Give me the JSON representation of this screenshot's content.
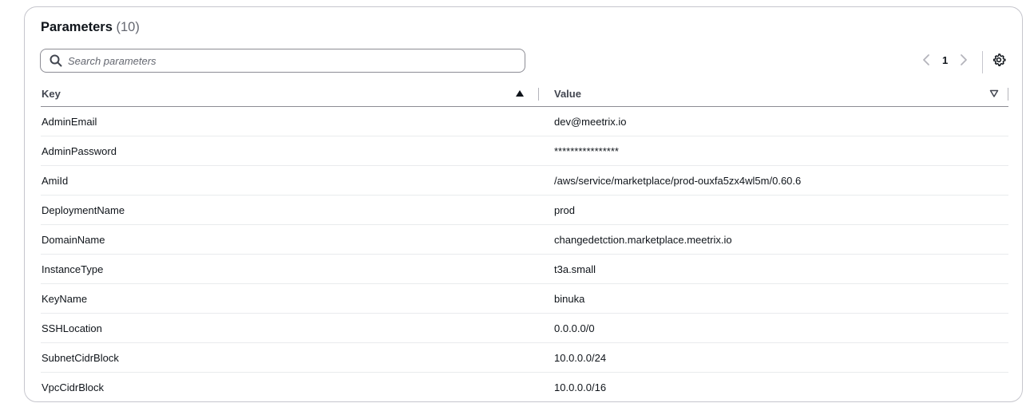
{
  "panel": {
    "title": "Parameters",
    "count": "(10)"
  },
  "search": {
    "placeholder": "Search parameters",
    "value": ""
  },
  "pagination": {
    "current_page": "1"
  },
  "table": {
    "columns": [
      "Key",
      "Value"
    ],
    "rows": [
      {
        "key": "AdminEmail",
        "value": "dev@meetrix.io"
      },
      {
        "key": "AdminPassword",
        "value": "****************"
      },
      {
        "key": "AmiId",
        "value": "/aws/service/marketplace/prod-ouxfa5zx4wl5m/0.60.6"
      },
      {
        "key": "DeploymentName",
        "value": "prod"
      },
      {
        "key": "DomainName",
        "value": "changedetction.marketplace.meetrix.io"
      },
      {
        "key": "InstanceType",
        "value": "t3a.small"
      },
      {
        "key": "KeyName",
        "value": "binuka"
      },
      {
        "key": "SSHLocation",
        "value": "0.0.0.0/0"
      },
      {
        "key": "SubnetCidrBlock",
        "value": "10.0.0.0/24"
      },
      {
        "key": "VpcCidrBlock",
        "value": "10.0.0.0/16"
      }
    ]
  },
  "icons": {
    "search": "search-icon",
    "prev": "chevron-left-icon",
    "next": "chevron-right-icon",
    "settings": "gear-icon",
    "sort_key": "sort-ascending-icon",
    "sort_value": "sort-descending-icon"
  },
  "colors": {
    "text": "#0f141a",
    "muted": "#656871",
    "border": "#c6c6cd"
  }
}
